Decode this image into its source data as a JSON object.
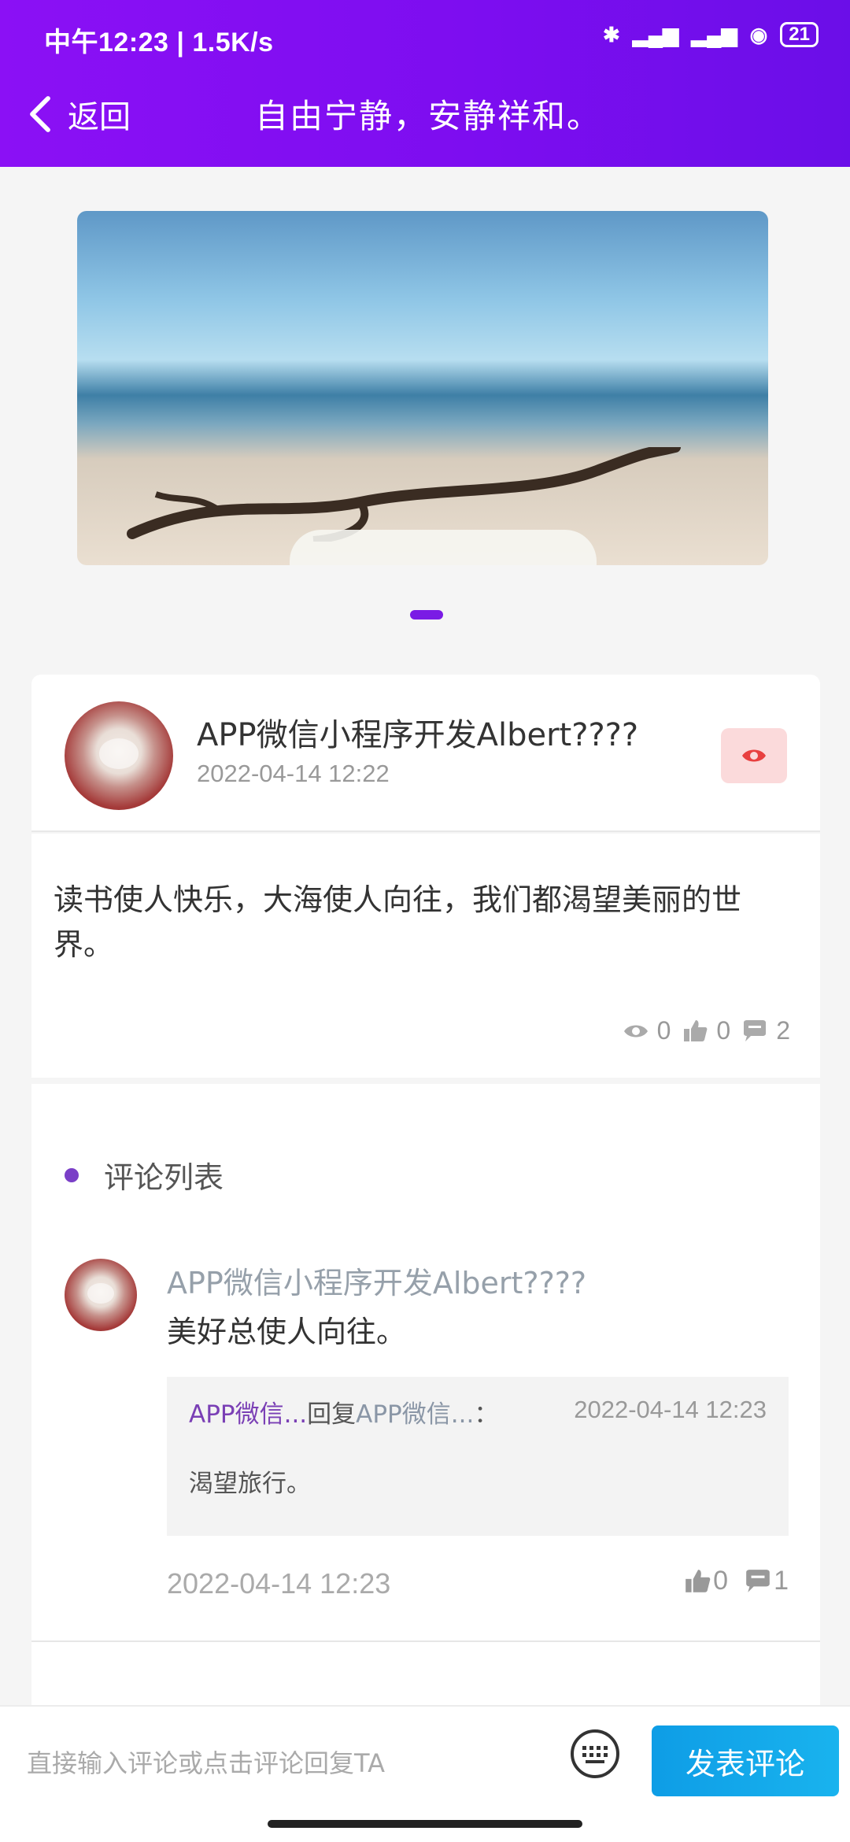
{
  "status_bar": {
    "time_and_speed": "中午12:23 | 1.5K/s",
    "battery": "21"
  },
  "navbar": {
    "back_label": "返回",
    "title": "自由宁静，安静祥和。"
  },
  "post": {
    "author": "APP微信小程序开发Albert????",
    "time": "2022-04-14 12:22",
    "text": "读书使人快乐，大海使人向往，我们都渴望美丽的世界。",
    "views": "0",
    "likes": "0",
    "comments": "2"
  },
  "comments_section": {
    "title": "评论列表",
    "items": [
      {
        "author": "APP微信小程序开发Albert????",
        "text": "美好总使人向往。",
        "reply": {
          "from": "APP微信...",
          "action": "回复",
          "to": "APP微信...",
          "colon": "：",
          "time": "2022-04-14 12:23",
          "text": "渴望旅行。"
        },
        "time": "2022-04-14 12:23",
        "likes": "0",
        "replies": "1"
      }
    ]
  },
  "bottom_bar": {
    "input_placeholder": "直接输入评论或点击评论回复TA",
    "send_label": "发表评论"
  },
  "colors": {
    "header_purple": "#7d0df0",
    "accent_purple": "#7a1be5",
    "send_blue": "#0e9de6"
  }
}
